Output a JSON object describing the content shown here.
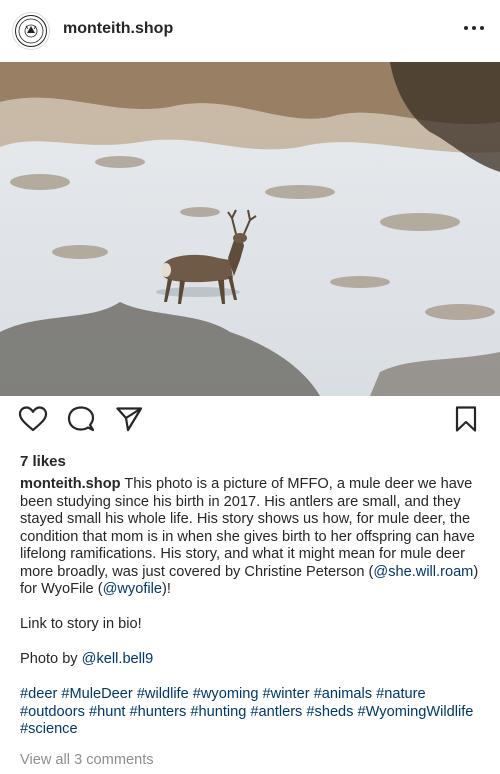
{
  "header": {
    "username": "monteith.shop",
    "avatar_text": "MONTEITH SHOP"
  },
  "post": {
    "likes": "7 likes",
    "caption_user": "monteith.shop",
    "caption_p1_a": " This photo is a picture of MFFO, a mule deer we have been studying since his birth in 2017. His antlers are small, and they stayed small his whole life. His story shows us how, for mule deer, the condition that mom is in when she gives birth to her offspring can have lifelong ramifications. His story, and what it might mean for mule deer more broadly, was just covered by Christine Peterson (",
    "mention_1": "@she.will.roam",
    "caption_p1_b": ") for WyoFile (",
    "mention_2": "@wyofile",
    "caption_p1_c": ")!",
    "caption_p2": "Link to story in bio!",
    "caption_p3_a": "Photo by ",
    "mention_3": "@kell.bell9",
    "hashtags": "#deer #MuleDeer #wildlife #wyoming #winter #animals #nature #outdoors #hunt #hunters #hunting #antlers #sheds #WyomingWildlife #science",
    "view_comments": "View all 3 comments"
  },
  "icons": {
    "like": "heart-icon",
    "comment": "comment-icon",
    "share": "send-icon",
    "save": "bookmark-icon",
    "more": "more-icon"
  },
  "colors": {
    "link": "#00376b",
    "muted": "#8e8e8e",
    "text": "#262626"
  }
}
